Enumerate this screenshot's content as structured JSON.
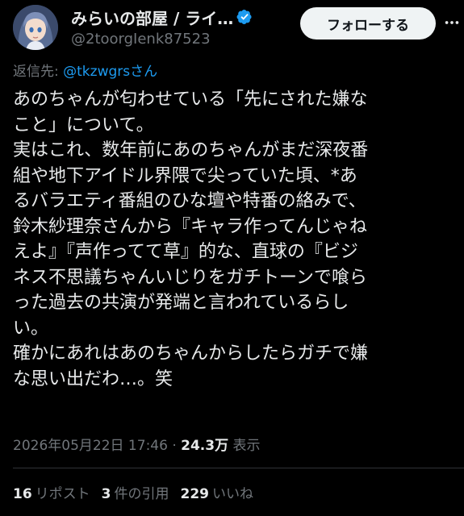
{
  "header": {
    "display_name": "みらいの部屋 / ライ…",
    "handle": "@2toorgIenk87523",
    "follow_label": "フォローする",
    "verified_color": "#1d9bf0"
  },
  "reply": {
    "prefix": "返信先: ",
    "mention": "@tkzwgrsさん"
  },
  "tweet": {
    "lines": [
      "あのちゃんが匂わせている「先にされた嫌な",
      "こと」について。",
      "実はこれ、数年前にあのちゃんがまだ深夜番",
      "組や地下アイドル界隈で尖っていた頃、*あ",
      "るバラエティ番組のひな壇や特番の絡みで、",
      "鈴木紗理奈さんから『キャラ作ってんじゃね",
      "えよ』『声作ってて草』的な、直球の『ビジ",
      "ネス不思議ちゃんいじりをガチトーンで喰ら",
      "った過去の共演が発端と言われているらし",
      "い。",
      "確かにあれはあのちゃんからしたらガチで嫌",
      "な思い出だわ…。笑"
    ]
  },
  "meta": {
    "datetime": "2026年05月22日 17:46 · ",
    "views_count": "24.3万",
    "views_label": " 表示"
  },
  "stats": {
    "reposts_count": "16",
    "reposts_label": "リポスト",
    "quotes_count": "3",
    "quotes_label": "件の引用",
    "likes_count": "229",
    "likes_label": "いいね"
  }
}
